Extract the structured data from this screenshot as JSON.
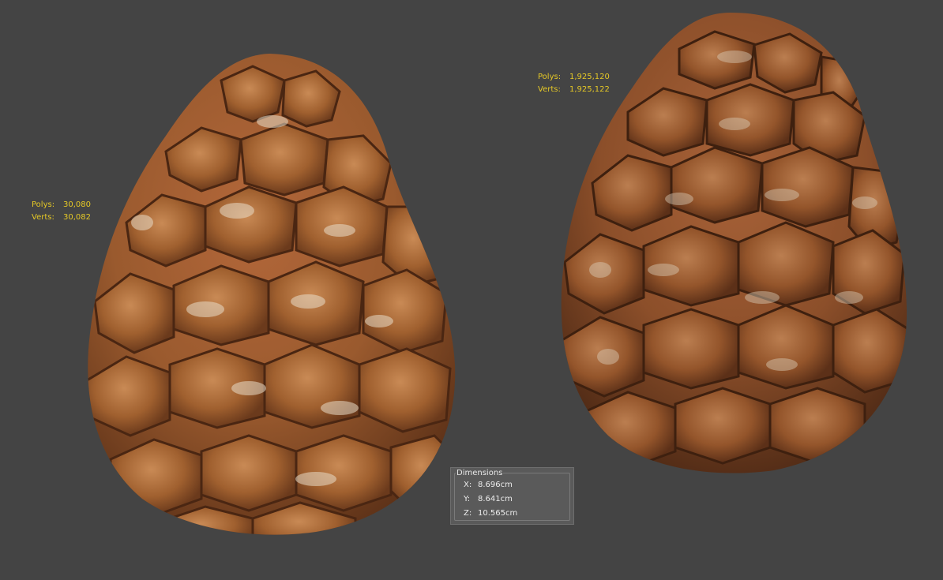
{
  "viewport": {
    "background": "#444444",
    "stats_color": "#e5c826"
  },
  "left_model": {
    "polys_label": "Polys:",
    "polys_value": "30,080",
    "verts_label": "Verts:",
    "verts_value": "30,082",
    "icon": "pine-cone-lowpoly"
  },
  "right_model": {
    "polys_label": "Polys:",
    "polys_value": "1,925,120",
    "verts_label": "Verts:",
    "verts_value": "1,925,122",
    "icon": "pine-cone-highpoly"
  },
  "dimensions": {
    "title": "Dimensions",
    "x_label": "X:",
    "x_value": "8.696cm",
    "y_label": "Y:",
    "y_value": "8.641cm",
    "z_label": "Z:",
    "z_value": "10.565cm"
  }
}
